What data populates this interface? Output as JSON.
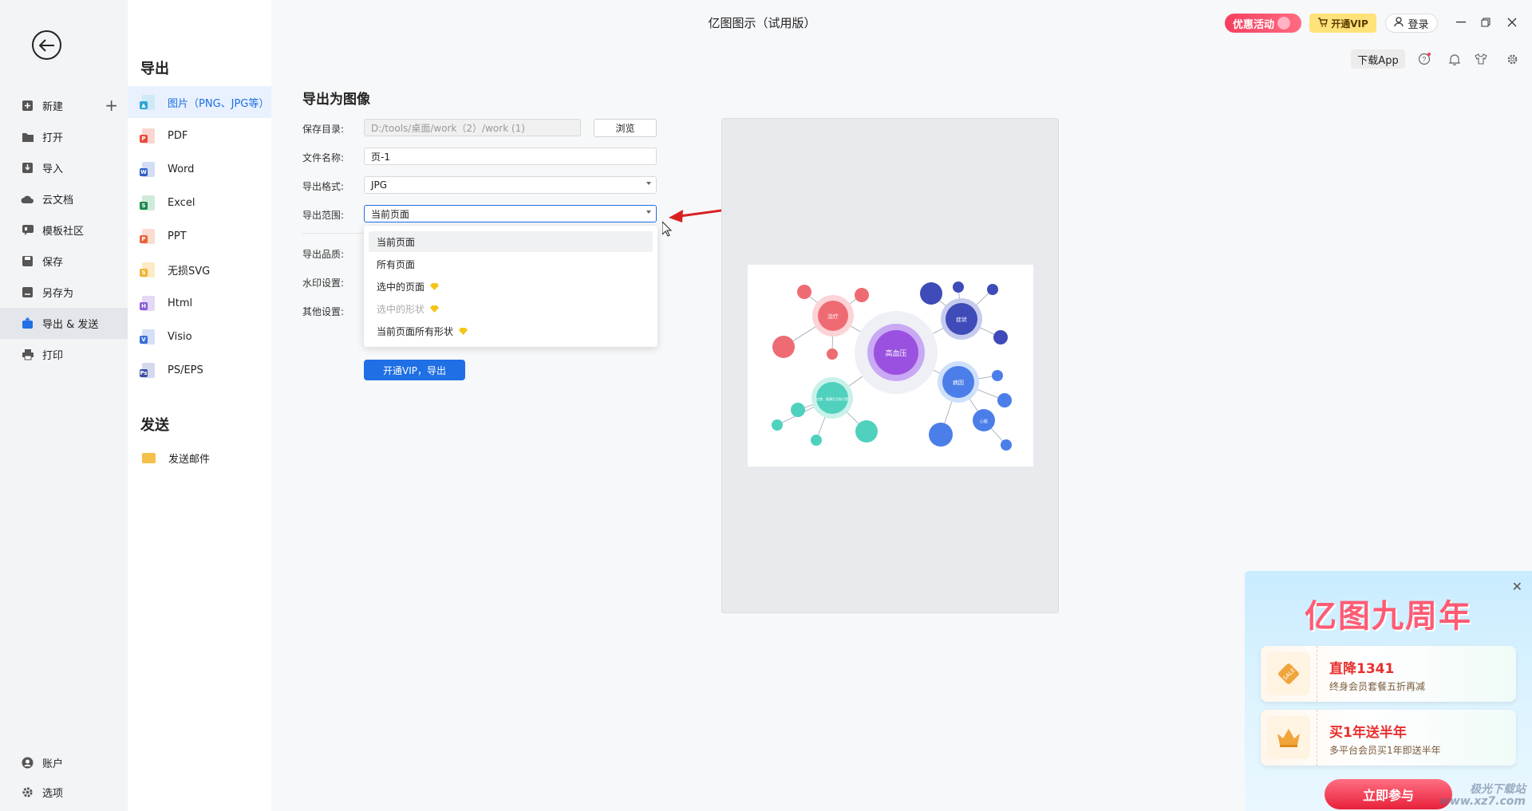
{
  "app": {
    "title": "亿图图示（试用版）"
  },
  "titlebar": {
    "promo_label": "优惠活动",
    "vip_label": "开通VIP",
    "login_label": "登录",
    "download_app_label": "下载App"
  },
  "leftnav": {
    "items": [
      {
        "label": "新建"
      },
      {
        "label": "打开"
      },
      {
        "label": "导入"
      },
      {
        "label": "云文档"
      },
      {
        "label": "模板社区"
      },
      {
        "label": "保存"
      },
      {
        "label": "另存为"
      },
      {
        "label": "导出 & 发送"
      },
      {
        "label": "打印"
      }
    ],
    "bottom": [
      {
        "label": "账户"
      },
      {
        "label": "选项"
      }
    ]
  },
  "export_panel": {
    "export_title": "导出",
    "items": [
      {
        "label": "图片（PNG、JPG等）",
        "color": "#2ea7d8"
      },
      {
        "label": "PDF",
        "color": "#e84c3d"
      },
      {
        "label": "Word",
        "color": "#2f5fc4"
      },
      {
        "label": "Excel",
        "color": "#1e8a4c"
      },
      {
        "label": "PPT",
        "color": "#e5643a"
      },
      {
        "label": "无损SVG",
        "color": "#f2b233"
      },
      {
        "label": "Html",
        "color": "#8b5cd6"
      },
      {
        "label": "Visio",
        "color": "#3a6fd8"
      },
      {
        "label": "PS/EPS",
        "color": "#3b4fa8"
      }
    ],
    "send_title": "发送",
    "send_items": [
      {
        "label": "发送邮件"
      }
    ]
  },
  "form": {
    "heading": "导出为图像",
    "save_dir_label": "保存目录:",
    "save_dir_value": "D:/tools/桌面/work（2）/work (1)",
    "browse_label": "浏览",
    "filename_label": "文件名称:",
    "filename_value": "页-1",
    "format_label": "导出格式:",
    "format_value": "JPG",
    "range_label": "导出范围:",
    "range_value": "当前页面",
    "quality_label": "导出品质:",
    "watermark_label": "水印设置:",
    "other_label": "其他设置:",
    "export_button": "开通VIP，导出"
  },
  "dropdown": {
    "options": [
      {
        "label": "当前页面",
        "selected": true,
        "disabled": false,
        "vip": false
      },
      {
        "label": "所有页面",
        "selected": false,
        "disabled": false,
        "vip": false
      },
      {
        "label": "选中的页面",
        "selected": false,
        "disabled": false,
        "vip": true
      },
      {
        "label": "选中的形状",
        "selected": false,
        "disabled": true,
        "vip": true
      },
      {
        "label": "当前页面所有形状",
        "selected": false,
        "disabled": false,
        "vip": true
      }
    ]
  },
  "preview": {
    "center_label": "高血压",
    "node_labels": [
      "治疗",
      "症状",
      "病因",
      "饮食、健康生活和习惯",
      "心脏"
    ]
  },
  "promo": {
    "title": "亿图九周年",
    "coupon1_title": "直降1341",
    "coupon1_sub": "终身会员套餐五折再减",
    "coupon1_badge": "SALE",
    "coupon2_title": "买1年送半年",
    "coupon2_sub": "多平台会员买1年即送半年",
    "join_label": "立即参与",
    "watermark_line1": "极光下载站",
    "watermark_line2": "www.xz7.com"
  },
  "colors": {
    "accent": "#1f6fe5",
    "promo_red": "#f43f5e",
    "vip_yellow": "#ffe27a"
  }
}
